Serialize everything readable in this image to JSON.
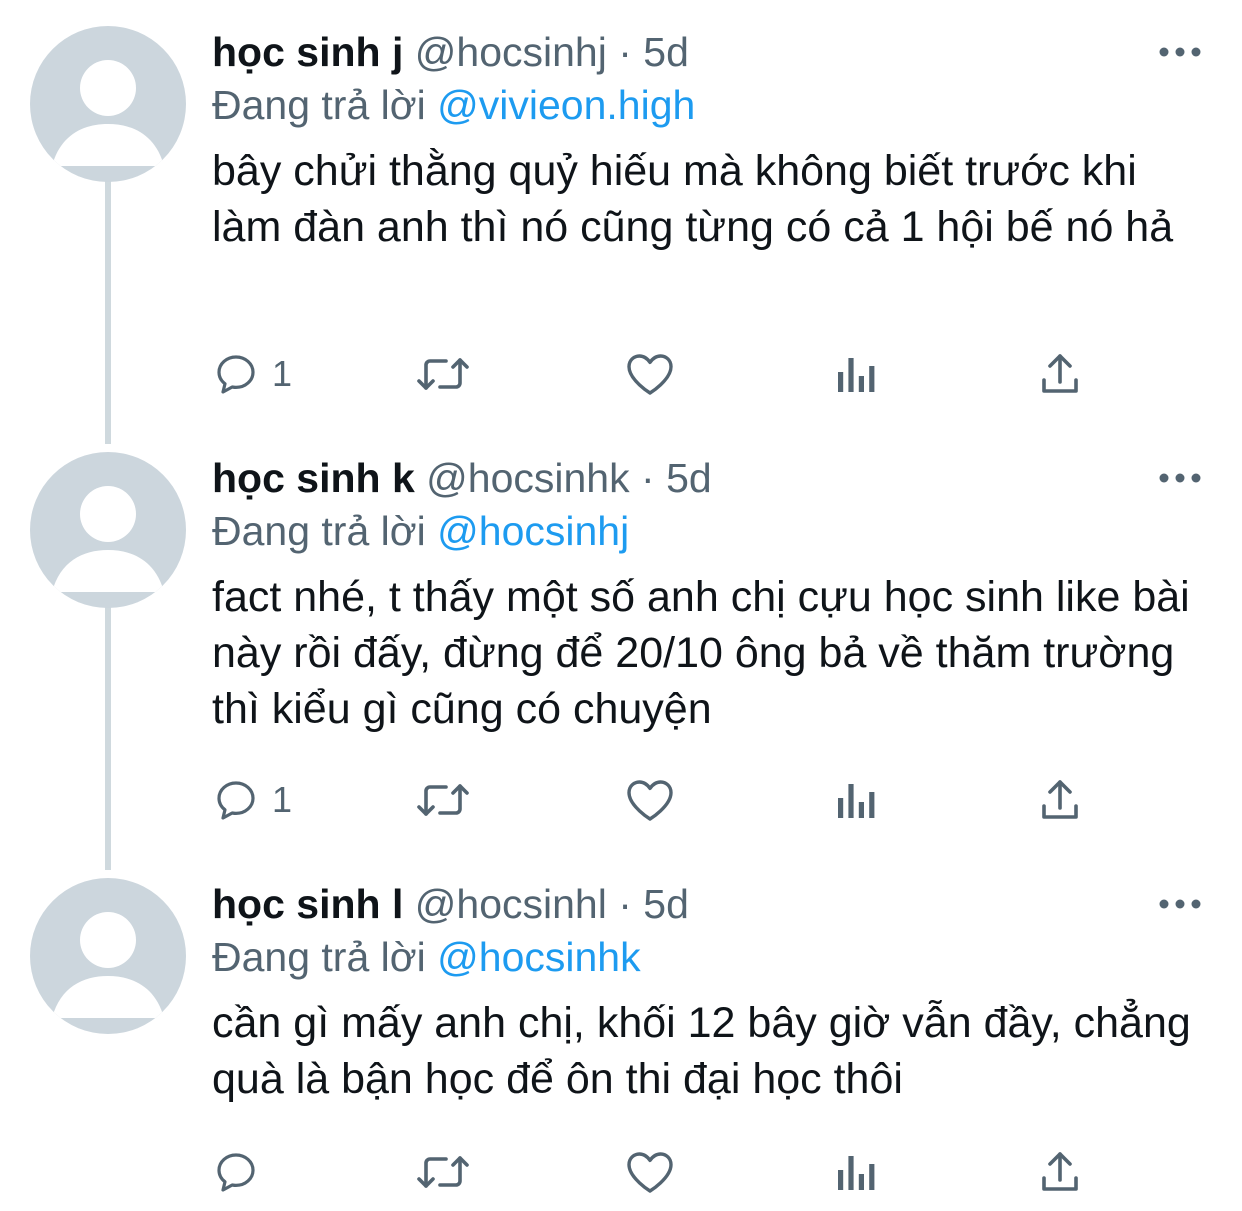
{
  "colors": {
    "accent": "#1d9bf0",
    "secondary_text": "#536471",
    "primary_text": "#0f1419",
    "avatar_bg": "#ccd6dd",
    "thread_line": "#cfd9de"
  },
  "icons": {
    "more": "more-horizontal-icon",
    "reply": "reply-bubble-icon",
    "retweet": "retweet-icon",
    "like": "heart-icon",
    "views": "views-bar-chart-icon",
    "share": "share-upload-icon"
  },
  "tweets": [
    {
      "display_name": "học sinh j",
      "handle": "@hocsinhj",
      "time": "· 5d",
      "replying_label": "Đang trả lời",
      "replying_to": "@vivieon.high",
      "text": "bây chửi thằng quỷ hiếu mà không biết trước khi làm đàn anh thì nó cũng từng có cả 1 hội bế nó hả",
      "reply_count": "1"
    },
    {
      "display_name": "học sinh k",
      "handle": "@hocsinhk",
      "time": "· 5d",
      "replying_label": "Đang trả lời",
      "replying_to": "@hocsinhj",
      "text": "fact nhé, t thấy một số anh chị cựu học sinh like bài này rồi đấy, đừng để 20/10 ông bả về thăm trường thì kiểu gì cũng có chuyện",
      "reply_count": "1"
    },
    {
      "display_name": "học sinh l",
      "handle": "@hocsinhl",
      "time": "· 5d",
      "replying_label": "Đang trả lời",
      "replying_to": "@hocsinhk",
      "text": "cần gì mấy anh chị, khối 12 bây giờ vẫn đầy, chẳng quà là bận học để ôn thi đại học thôi",
      "reply_count": ""
    }
  ]
}
